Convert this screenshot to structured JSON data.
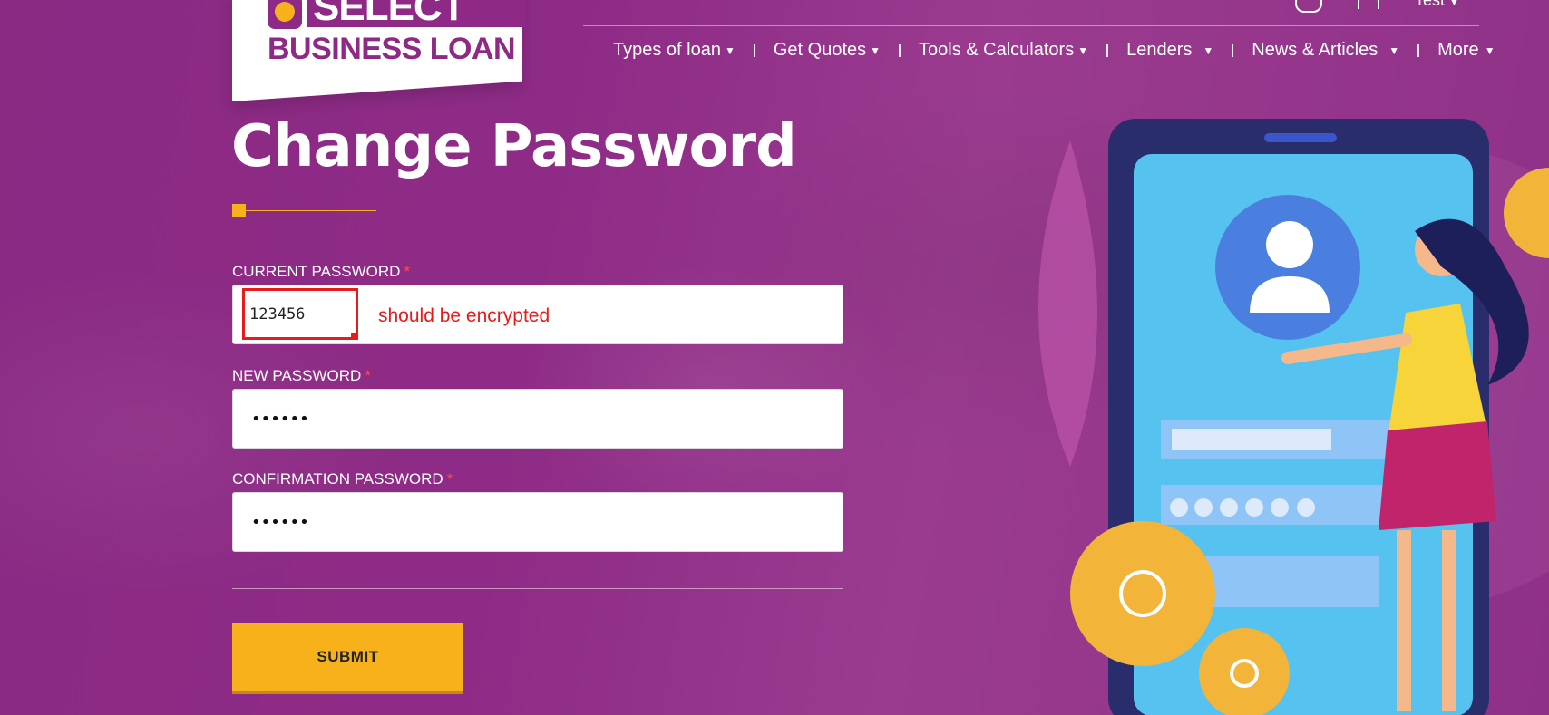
{
  "brand": {
    "logo_top": "SELECT",
    "logo_bottom": "BUSINESS LOAN"
  },
  "header": {
    "user_name": "Test",
    "nav": [
      {
        "label": "Types of loan"
      },
      {
        "label": "Get Quotes"
      },
      {
        "label": "Tools & Calculators"
      },
      {
        "label": "Lenders"
      },
      {
        "label": "News & Articles"
      },
      {
        "label": "More"
      }
    ]
  },
  "page": {
    "title": "Change Password"
  },
  "form": {
    "current": {
      "label": "CURRENT PASSWORD",
      "required_mark": "*",
      "value": "123456"
    },
    "new": {
      "label": "NEW PASSWORD",
      "required_mark": "*",
      "value": "••••••"
    },
    "confirm": {
      "label": "CONFIRMATION PASSWORD",
      "required_mark": "*",
      "value": "••••••"
    },
    "submit_label": "SUBMIT"
  },
  "annotation": {
    "note": "should be encrypted",
    "color": "#e81a1a"
  },
  "colors": {
    "background": "#8e2b86",
    "accent": "#f7b21b",
    "brand_purple": "#8e2a86"
  }
}
